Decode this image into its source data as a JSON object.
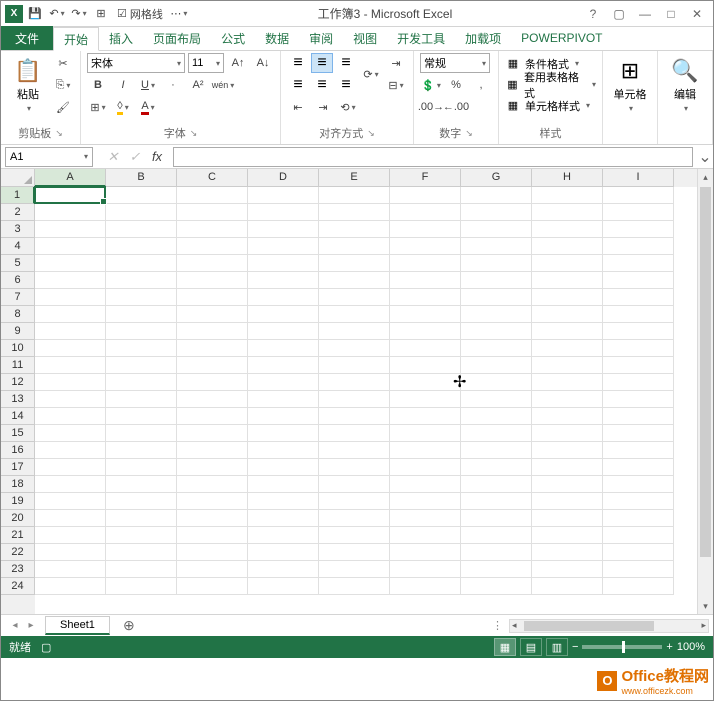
{
  "titlebar": {
    "gridlines_label": "网格线",
    "title": "工作簿3 - Microsoft Excel"
  },
  "tabs": {
    "file": "文件",
    "items": [
      "开始",
      "插入",
      "页面布局",
      "公式",
      "数据",
      "审阅",
      "视图",
      "开发工具",
      "加载项",
      "POWERPIVOT"
    ],
    "active": 0
  },
  "ribbon": {
    "clipboard": {
      "paste": "粘贴",
      "label": "剪贴板"
    },
    "font": {
      "name": "宋体",
      "size": "11",
      "label": "字体"
    },
    "alignment": {
      "label": "对齐方式"
    },
    "number": {
      "format": "常规",
      "label": "数字"
    },
    "styles": {
      "cond": "条件格式",
      "table": "套用表格格式",
      "cell": "单元格样式",
      "label": "样式"
    },
    "cells": {
      "label": "单元格"
    },
    "editing": {
      "label": "编辑"
    }
  },
  "formula": {
    "name_box": "A1"
  },
  "grid": {
    "cols": [
      "A",
      "B",
      "C",
      "D",
      "E",
      "F",
      "G",
      "H",
      "I"
    ],
    "rows": [
      1,
      2,
      3,
      4,
      5,
      6,
      7,
      8,
      9,
      10,
      11,
      12,
      13,
      14,
      15,
      16,
      17,
      18,
      19,
      20,
      21,
      22,
      23,
      24
    ]
  },
  "sheets": {
    "active": "Sheet1"
  },
  "status": {
    "ready": "就绪",
    "zoom": "100%"
  },
  "watermark": {
    "name": "Office教程网",
    "url": "www.officezk.com"
  }
}
